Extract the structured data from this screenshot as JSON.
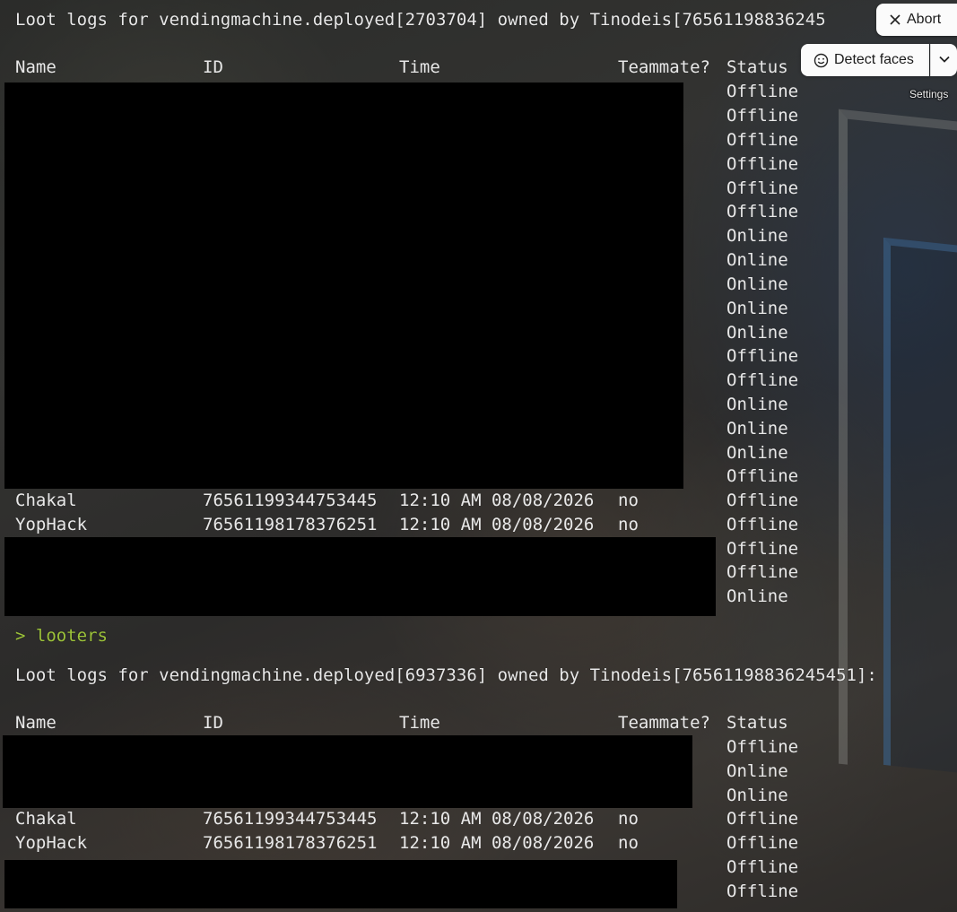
{
  "overlay": {
    "abort_label": "Abort",
    "detect_faces_label": "Detect faces",
    "settings_label": "Settings"
  },
  "log1": {
    "header": "Loot logs for vendingmachine.deployed[2703704] owned by Tinodeis[76561198836245",
    "columns": {
      "name": "Name",
      "id": "ID",
      "time": "Time",
      "teammate": "Teammate?",
      "status": "Status"
    },
    "statuses": [
      "Offline",
      "Offline",
      "Offline",
      "Offline",
      "Offline",
      "Offline",
      "Online",
      "Online",
      "Online",
      "Online",
      "Online",
      "Offline",
      "Offline",
      "Online",
      "Online",
      "Online",
      "Offline",
      "Offline",
      "Offline",
      "Offline",
      "Offline",
      "Online"
    ],
    "rows": [
      {
        "name": "Chakal",
        "id": "76561199344753445",
        "time": "12:10 AM 08/08/2026",
        "teammate": "no"
      },
      {
        "name": "YopHack",
        "id": "76561198178376251",
        "time": "12:10 AM 08/08/2026",
        "teammate": "no"
      }
    ]
  },
  "prompt": {
    "text": "> looters",
    "color": "#9dc33a"
  },
  "log2": {
    "header": "Loot logs for vendingmachine.deployed[6937336] owned by Tinodeis[76561198836245451]:",
    "columns": {
      "name": "Name",
      "id": "ID",
      "time": "Time",
      "teammate": "Teammate?",
      "status": "Status"
    },
    "statuses": [
      "Offline",
      "Online",
      "Online",
      "Offline",
      "Offline",
      "Offline",
      "Offline"
    ],
    "rows": [
      {
        "name": "Chakal",
        "id": "76561199344753445",
        "time": "12:10 AM 08/08/2026",
        "teammate": "no"
      },
      {
        "name": "YopHack",
        "id": "76561198178376251",
        "time": "12:10 AM 08/08/2026",
        "teammate": "no"
      }
    ]
  }
}
